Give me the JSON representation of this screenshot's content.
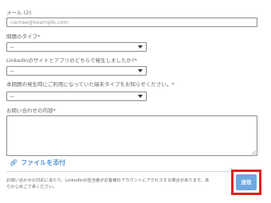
{
  "form": {
    "email": {
      "label": "メール (2):",
      "placeholder": "namae@example.com"
    },
    "issue_type": {
      "label": "問題のタイプ*",
      "selected": "--"
    },
    "platform": {
      "label": "LinkedInのサイトとアプリのどちらで発生しましたか?*",
      "selected": "--"
    },
    "device_type": {
      "label": "本問題の発生時にご利用になっていた端末タイプをお知らせください。*",
      "selected": "--"
    },
    "message": {
      "label": "お問い合わせの内容*",
      "value": ""
    },
    "attach_label": "ファイルを添付",
    "attach_icon": "paperclip-icon",
    "notice_line1": "お問い合わせの対応にあたり、LinkedInの担当者がお客様のアカウントにアクセスする場合があります。あ",
    "notice_line2": "らかじめご了承ください。",
    "submit_label": "送信"
  },
  "colors": {
    "link": "#0a66c2",
    "submit_bg": "#70a8e0",
    "highlight": "#e02020",
    "border": "#8c8c8c"
  }
}
